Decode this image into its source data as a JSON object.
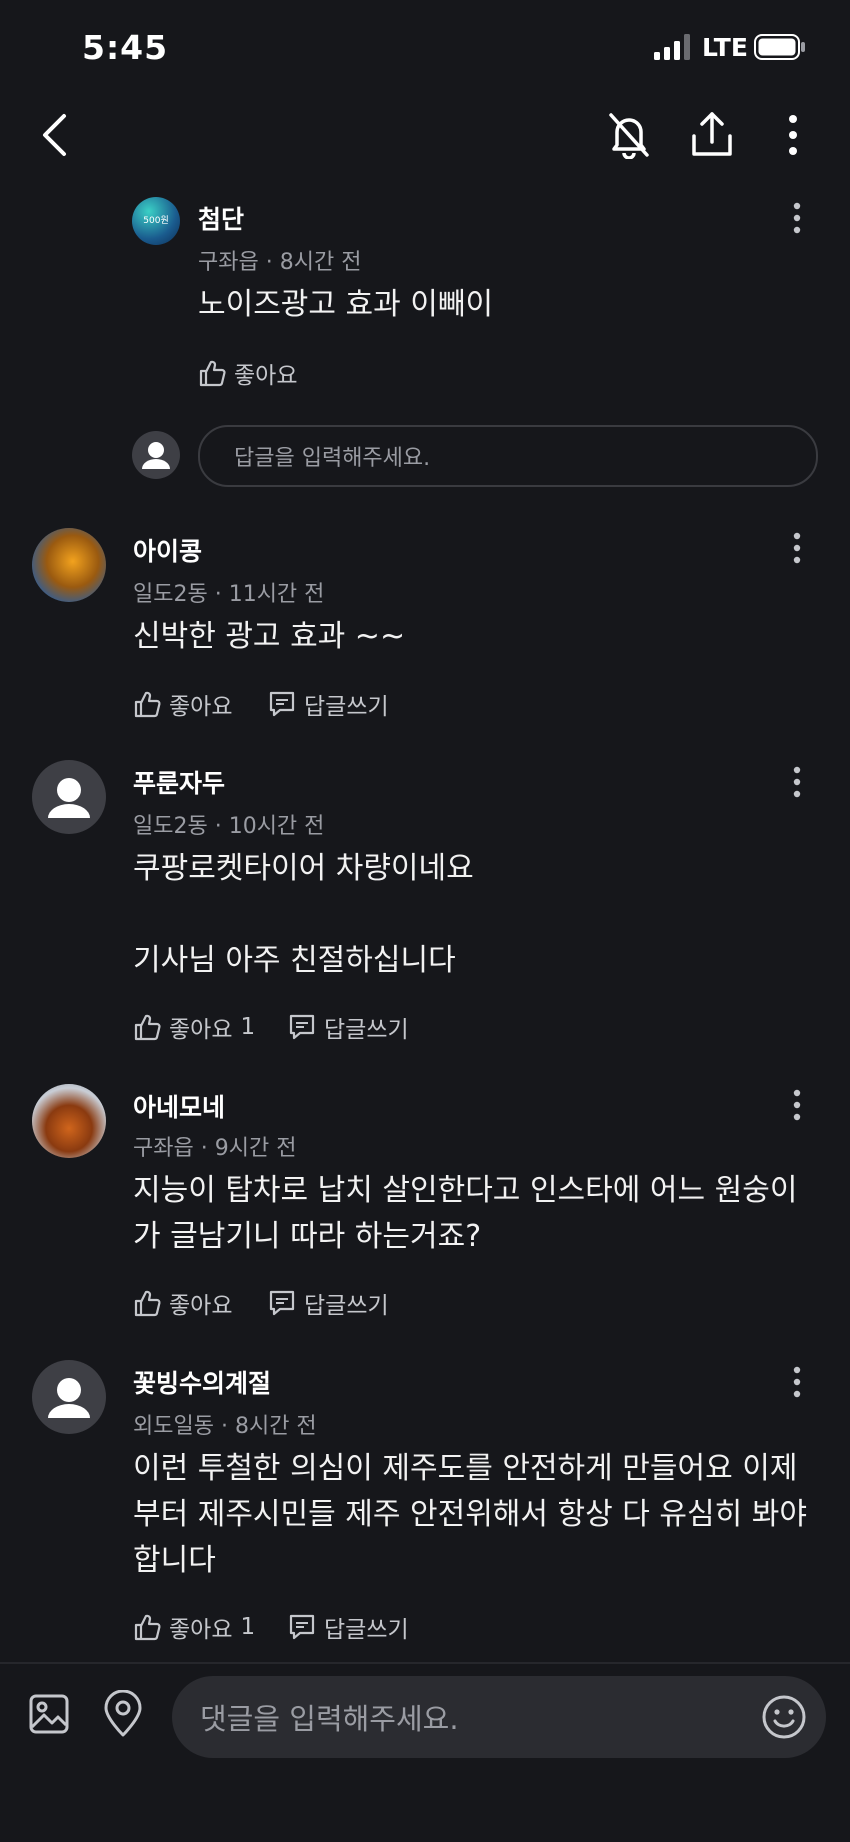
{
  "status_bar": {
    "time": "5:45",
    "network": "LTE"
  },
  "comments": [
    {
      "author": "첨단",
      "location": "구좌읍",
      "time": "8시간 전",
      "text": "노이즈광고 효과 이빼이",
      "like_label": "좋아요",
      "like_count": "",
      "avatar_label": "500원"
    },
    {
      "author": "아이콩",
      "location": "일도2동",
      "time": "11시간 전",
      "text": "신박한 광고 효과 ~~",
      "like_label": "좋아요",
      "like_count": "",
      "reply_label": "답글쓰기"
    },
    {
      "author": "푸룬자두",
      "location": "일도2동",
      "time": "10시간 전",
      "text": "쿠팡로켓타이어 차량이네요\n\n기사님 아주 친절하십니다",
      "like_label": "좋아요",
      "like_count": "1",
      "reply_label": "답글쓰기"
    },
    {
      "author": "아네모네",
      "location": "구좌읍",
      "time": "9시간 전",
      "text": "지능이 탑차로 납치 살인한다고 인스타에 어느 원숭이가 글남기니 따라 하는거죠?",
      "like_label": "좋아요",
      "like_count": "",
      "reply_label": "답글쓰기"
    },
    {
      "author": "꽃빙수의계절",
      "location": "외도일동",
      "time": "8시간 전",
      "text": "이런 투철한 의심이 제주도를 안전하게 만들어요 이제부터 제주시민들 제주 안전위해서 항상 다 유심히 봐야합니다",
      "like_label": "좋아요",
      "like_count": "1",
      "reply_label": "답글쓰기"
    }
  ],
  "reply_input": {
    "placeholder": "답글을 입력해주세요."
  },
  "comment_input": {
    "placeholder": "댓글을 입력해주세요."
  },
  "colors": {
    "background": "#16171b",
    "input_bg": "#2b2c31",
    "muted_text": "#9a9ca3"
  }
}
